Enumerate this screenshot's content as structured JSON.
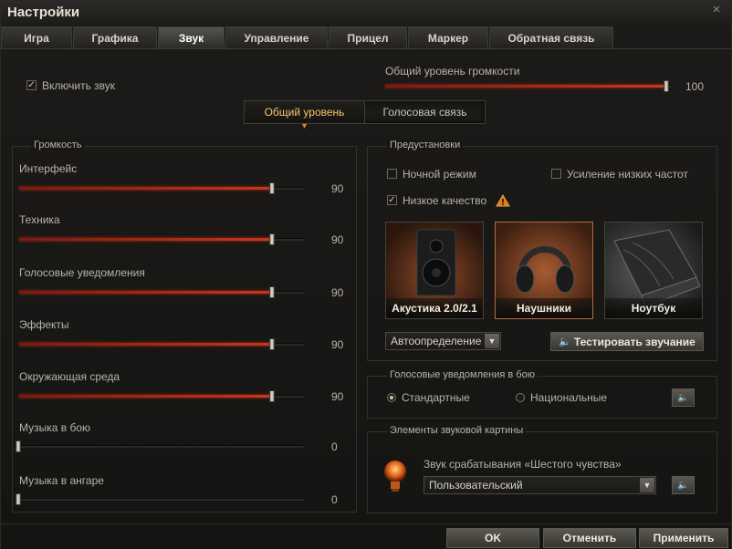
{
  "window": {
    "title": "Настройки",
    "close_symbol": "×"
  },
  "tabs": [
    {
      "label": "Игра",
      "active": false
    },
    {
      "label": "Графика",
      "active": false
    },
    {
      "label": "Звук",
      "active": true
    },
    {
      "label": "Управление",
      "active": false
    },
    {
      "label": "Прицел",
      "active": false
    },
    {
      "label": "Маркер",
      "active": false
    },
    {
      "label": "Обратная связь",
      "active": false
    }
  ],
  "enable_sound": {
    "label": "Включить звук",
    "checked": true
  },
  "master_volume": {
    "label": "Общий уровень громкости",
    "value": 100
  },
  "mode_tabs": [
    {
      "label": "Общий уровень",
      "active": true
    },
    {
      "label": "Голосовая связь",
      "active": false
    }
  ],
  "volume": {
    "title": "Громкость",
    "items": [
      {
        "label": "Интерфейс",
        "value": 90
      },
      {
        "label": "Техника",
        "value": 90
      },
      {
        "label": "Голосовые уведомления",
        "value": 90
      },
      {
        "label": "Эффекты",
        "value": 90
      },
      {
        "label": "Окружающая среда",
        "value": 90
      },
      {
        "label": "Музыка в бою",
        "value": 0
      },
      {
        "label": "Музыка в ангаре",
        "value": 0
      }
    ]
  },
  "presets": {
    "title": "Предустановки",
    "night_mode": {
      "label": "Ночной режим",
      "checked": false
    },
    "bass_boost": {
      "label": "Усиление низких частот",
      "checked": false
    },
    "low_quality": {
      "label": "Низкое качество",
      "checked": true,
      "warning_icon": "warning-icon"
    },
    "devices": [
      {
        "label": "Акустика 2.0/2.1",
        "icon": "speaker-icon",
        "active": false
      },
      {
        "label": "Наушники",
        "icon": "headphones-icon",
        "active": true
      },
      {
        "label": "Ноутбук",
        "icon": "laptop-icon",
        "active": false
      }
    ],
    "device_select": "Автоопределение",
    "test_button": "Тестировать звучание"
  },
  "voice_notifications": {
    "title": "Голосовые уведомления в бою",
    "options": [
      {
        "label": "Стандартные",
        "selected": true
      },
      {
        "label": "Национальные",
        "selected": false
      }
    ]
  },
  "sound_elements": {
    "title": "Элементы звуковой картины",
    "sixth_sense_label": "Звук срабатывания «Шестого чувства»",
    "sixth_sense_value": "Пользовательский",
    "icon": "lightbulb-icon"
  },
  "footer": {
    "ok": "OK",
    "cancel": "Отменить",
    "apply": "Применить"
  },
  "colors": {
    "accent_orange": "#f4c76c",
    "slider_fill": "#c8361e",
    "background": "#141412"
  }
}
